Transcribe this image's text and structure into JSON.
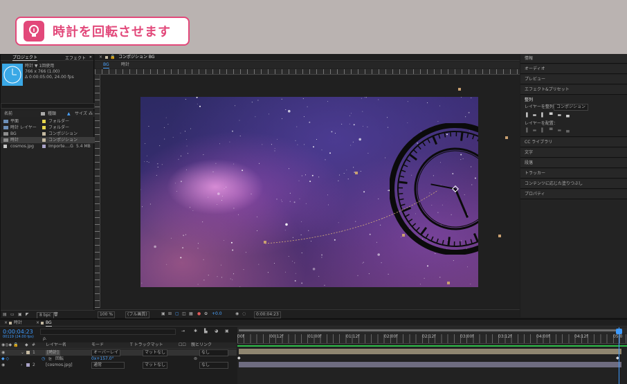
{
  "banner": {
    "title": "時計を回転させます",
    "icon": "lightbulb-icon",
    "accent": "#e2487a"
  },
  "project": {
    "tabs": [
      "プロジェクト",
      "エフェクト"
    ],
    "selected_item": {
      "name": "時計 ▼ 1回使用",
      "dims": "766 x 766 (1.00)",
      "duration": "Δ 0:00:05:00, 24.00 fps"
    },
    "search_placeholder": "ρ.",
    "columns": {
      "name": "名前",
      "type": "種類",
      "size": "サイズ"
    },
    "items": [
      {
        "name": "平面",
        "type": "フォルダー",
        "size": "",
        "color": "#e7d64d"
      },
      {
        "name": "時計 レイヤー",
        "type": "フォルダー",
        "size": "",
        "color": "#e7d64d"
      },
      {
        "name": "BG",
        "type": "コンポジション",
        "size": "",
        "color": "#c4b9a1"
      },
      {
        "name": "時計",
        "type": "コンポジション",
        "size": "",
        "color": "#c4b9a1"
      },
      {
        "name": "cosmos.jpg",
        "type": "Importe....G",
        "size": "5.4 MB",
        "color": "#a9a3c8"
      }
    ],
    "bpc": "8 bpc"
  },
  "comp": {
    "tab": "コンポジション BG",
    "breadcrumbs": [
      "BG",
      "時計"
    ],
    "zoom": "100 %",
    "resolution": "(フル画質)",
    "exposure": "+0.0",
    "timecode": "0:00:04:23"
  },
  "right_panels": [
    "情報",
    "オーディオ",
    "プレビュー",
    "エフェクト&プリセット"
  ],
  "align": {
    "title": "整列",
    "layer_align": "レイヤーを整列：",
    "target": "コンポジション",
    "distribute": "レイヤーを配置："
  },
  "right_panels_lower": [
    "CC ライブラリ",
    "文字",
    "段落",
    "トラッカー",
    "コンテンツに応じた塗りつぶし",
    "プロパティ"
  ],
  "timeline": {
    "tabs": [
      "時計",
      "BG"
    ],
    "time": "0:00:04:23",
    "fps": "00119 (24.00 fps)",
    "columns": {
      "layer": "レイヤー名",
      "mode": "モード",
      "trkmat": "T  トラックマット",
      "parent": "親とリンク"
    },
    "layers": [
      {
        "num": "1",
        "name": "[時計]",
        "mode": "オーバーレイ",
        "matte": "マットなし",
        "parent": "なし",
        "color": "#c4b9a1"
      },
      {
        "num": "",
        "name": "回転",
        "mode": "0x+157.0°",
        "matte": "",
        "parent": "",
        "color": ""
      },
      {
        "num": "2",
        "name": "[cosmos.jpg]",
        "mode": "通常",
        "matte": "マットなし",
        "parent": "なし",
        "color": "#a9a3c8"
      }
    ],
    "ruler": [
      "00f",
      "00:12f",
      "01:00f",
      "01:12f",
      "02:00f",
      "02:12f",
      "03:00f",
      "03:12f",
      "04:00f",
      "04:12f",
      "05:0"
    ]
  }
}
